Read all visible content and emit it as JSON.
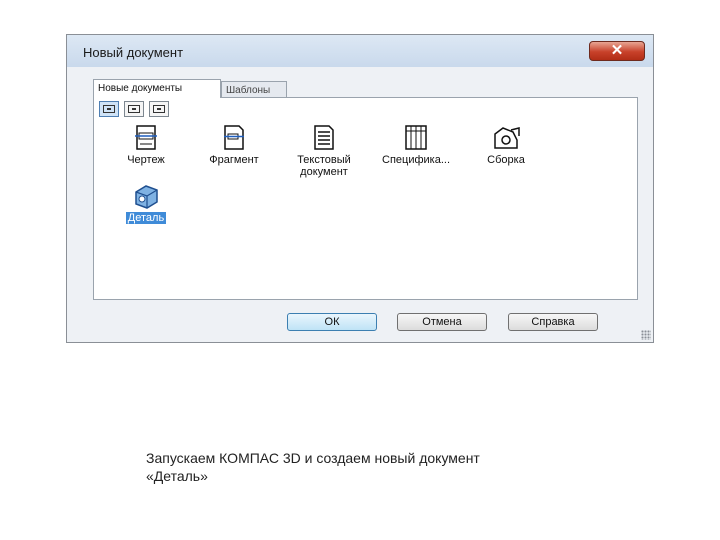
{
  "dialog": {
    "title": "Новый документ",
    "close_symbol": "✕",
    "tabs": [
      {
        "label": "Новые документы",
        "active": true
      },
      {
        "label": "Шаблоны",
        "active": false
      }
    ],
    "view_buttons": [
      "large-icons-view-icon",
      "list-view-icon",
      "details-view-icon"
    ],
    "documents": [
      {
        "label": "Чертеж",
        "icon": "drawing-icon",
        "selected": false
      },
      {
        "label": "Фрагмент",
        "icon": "fragment-icon",
        "selected": false
      },
      {
        "label": "Текстовый документ",
        "icon": "text-document-icon",
        "selected": false
      },
      {
        "label": "Специфика...",
        "icon": "specification-icon",
        "selected": false
      },
      {
        "label": "Сборка",
        "icon": "assembly-icon",
        "selected": false
      },
      {
        "label": "Деталь",
        "icon": "part-icon",
        "selected": true
      }
    ],
    "buttons": {
      "ok": "ОК",
      "cancel": "Отмена",
      "help": "Справка"
    }
  },
  "caption": {
    "line1": "Запускаем КОМПАС 3D и создаем новый документ",
    "line2": "«Деталь»"
  },
  "colors": {
    "selection": "#3f8bd8",
    "close_button": "#c8412a",
    "default_button": "#bfe3f6"
  }
}
